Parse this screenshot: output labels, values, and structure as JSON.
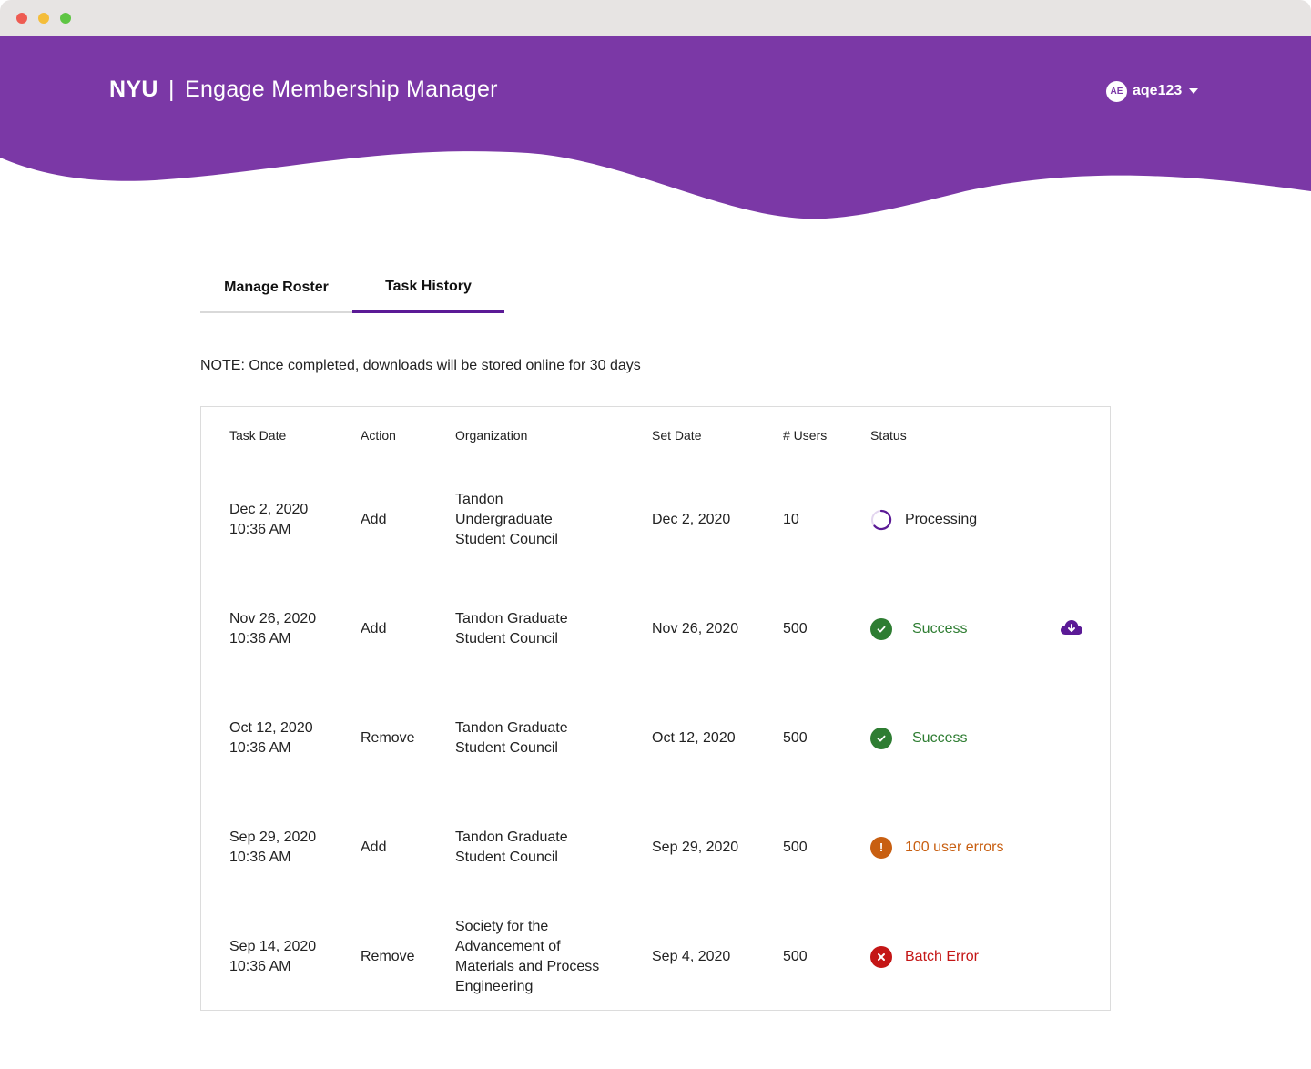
{
  "app": {
    "brand": "NYU",
    "separator": "|",
    "title": "Engage Membership Manager",
    "colors": {
      "header": "#7b38a6",
      "accent": "#5b1a96",
      "success": "#2e7d32",
      "warning": "#c85f11",
      "error": "#c41616"
    }
  },
  "user": {
    "initials": "AE",
    "username": "aqe123"
  },
  "tabs": [
    {
      "label": "Manage Roster",
      "active": false
    },
    {
      "label": "Task History",
      "active": true
    }
  ],
  "note": "NOTE: Once completed, downloads will be stored online for 30 days",
  "table": {
    "headers": {
      "task_date": "Task Date",
      "action": "Action",
      "organization": "Organization",
      "set_date": "Set Date",
      "users": "# Users",
      "status": "Status"
    },
    "rows": [
      {
        "task_date": "Dec 2, 2020",
        "task_time": "10:36 AM",
        "action": "Add",
        "org_lines": [
          "Tandon",
          "Undergraduate",
          "Student Council"
        ],
        "set_date": "Dec 2, 2020",
        "users": "10",
        "status": "Processing",
        "status_type": "processing",
        "status_icon": "spinner-icon",
        "download": false
      },
      {
        "task_date": "Nov 26, 2020",
        "task_time": "10:36 AM",
        "action": "Add",
        "org_lines": [
          "Tandon Graduate",
          "Student Council"
        ],
        "set_date": "Nov 26, 2020",
        "users": "500",
        "status": "Success",
        "status_type": "success",
        "status_icon": "check-circle-icon",
        "download": true
      },
      {
        "task_date": "Oct 12, 2020",
        "task_time": "10:36 AM",
        "action": "Remove",
        "org_lines": [
          "Tandon Graduate",
          "Student Council"
        ],
        "set_date": "Oct 12, 2020",
        "users": "500",
        "status": "Success",
        "status_type": "success",
        "status_icon": "check-circle-icon",
        "download": false
      },
      {
        "task_date": "Sep 29, 2020",
        "task_time": "10:36 AM",
        "action": "Add",
        "org_lines": [
          "Tandon Graduate",
          "Student Council"
        ],
        "set_date": "Sep 29, 2020",
        "users": "500",
        "status": "100 user errors",
        "status_type": "warning",
        "status_icon": "exclamation-circle-icon",
        "download": false
      },
      {
        "task_date": "Sep 14, 2020",
        "task_time": "10:36 AM",
        "action": "Remove",
        "org_lines": [
          "Society for the",
          "Advancement of",
          "Materials and Process",
          "Engineering"
        ],
        "set_date": "Sep 4, 2020",
        "users": "500",
        "status": "Batch Error",
        "status_type": "error",
        "status_icon": "x-circle-icon",
        "download": false
      }
    ]
  }
}
